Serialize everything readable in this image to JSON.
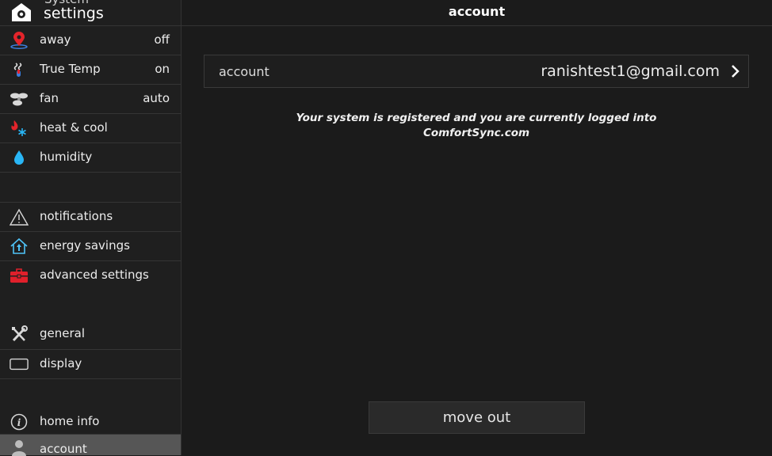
{
  "sidebar": {
    "header": {
      "subtitle": "System",
      "title": "settings"
    },
    "items": [
      {
        "label": "away",
        "value": "off",
        "icon": "map-pin-icon"
      },
      {
        "label": "True Temp",
        "value": "on",
        "icon": "true-temp-icon"
      },
      {
        "label": "fan",
        "value": "auto",
        "icon": "fan-icon"
      },
      {
        "label": "heat & cool",
        "value": "",
        "icon": "flame-snowflake-icon"
      },
      {
        "label": "humidity",
        "value": "",
        "icon": "droplet-icon"
      },
      {
        "label": "notifications",
        "value": "",
        "icon": "warning-triangle-icon"
      },
      {
        "label": "energy savings",
        "value": "",
        "icon": "energy-house-icon"
      },
      {
        "label": "advanced settings",
        "value": "",
        "icon": "toolbox-icon"
      },
      {
        "label": "general",
        "value": "",
        "icon": "wrench-screwdriver-icon"
      },
      {
        "label": "display",
        "value": "",
        "icon": "display-icon"
      },
      {
        "label": "home info",
        "value": "",
        "icon": "info-icon"
      },
      {
        "label": "account",
        "value": "",
        "icon": "user-icon",
        "active": true
      }
    ]
  },
  "main": {
    "title": "account",
    "account_row": {
      "label": "account",
      "email": "ranishtest1@gmail.com"
    },
    "message_line1": "Your system is registered and you are currently logged into",
    "message_line2": "ComfortSync.com",
    "move_out_label": "move out"
  },
  "colors": {
    "background": "#1b1b1b",
    "active_row": "#565656",
    "away_red": "#e3242b",
    "humidity_blue": "#29b6f6",
    "energy_blue": "#4fc3f7",
    "toolbox_red": "#e0202b"
  }
}
